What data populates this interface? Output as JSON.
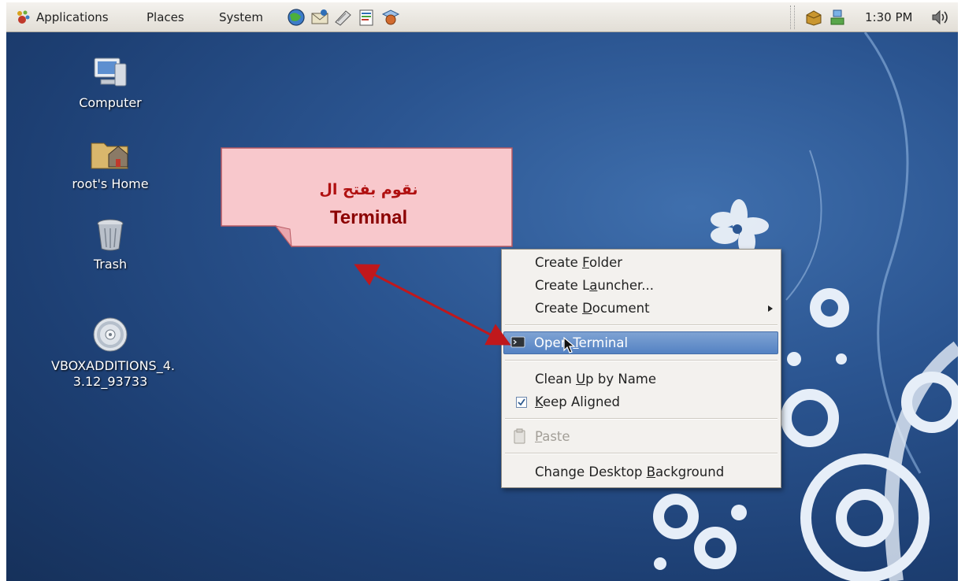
{
  "panel": {
    "menus": [
      "Applications",
      "Places",
      "System"
    ],
    "launchers": [
      "web-browser-icon",
      "email-icon",
      "notes-icon",
      "writer-icon",
      "presentation-icon"
    ],
    "tray_icons": [
      "update-icon",
      "network-icon"
    ],
    "clock": "1:30 PM",
    "volume_icon": "volume-icon"
  },
  "desktop_icons": [
    {
      "label": "Computer",
      "icon": "computer-icon"
    },
    {
      "label": "root's Home",
      "icon": "home-folder-icon"
    },
    {
      "label": "Trash",
      "icon": "trash-icon"
    },
    {
      "label_line1": "VBOXADDITIONS_4.",
      "label_line2": "3.12_93733",
      "icon": "cd-icon"
    }
  ],
  "callout": {
    "text_arabic": "نقوم بفتح ال",
    "text_english": "Terminal"
  },
  "context_menu": {
    "create_folder": {
      "pre": "Create ",
      "u": "F",
      "post": "older"
    },
    "create_launcher": {
      "pre": "Create L",
      "u": "a",
      "post": "uncher..."
    },
    "create_document": {
      "pre": "Create ",
      "u": "D",
      "post": "ocument"
    },
    "open_terminal": {
      "pre": "Ope",
      "mid": "n ",
      "u": "T",
      "post": "erminal"
    },
    "clean_up": {
      "pre": "Clean ",
      "u": "U",
      "post": "p by Name"
    },
    "keep_aligned": {
      "pre": "",
      "u": "K",
      "post": "eep Aligned",
      "checked": true
    },
    "paste": {
      "pre": "",
      "u": "P",
      "post": "aste",
      "enabled": false
    },
    "change_background": {
      "pre": "Change Desktop ",
      "u": "B",
      "post": "ackground"
    }
  },
  "colors": {
    "desktop_blue": "#2b5591",
    "menu_highlight": "#5482c3",
    "callout_fill": "#f8c8cc",
    "arrow_red": "#c0181c"
  }
}
